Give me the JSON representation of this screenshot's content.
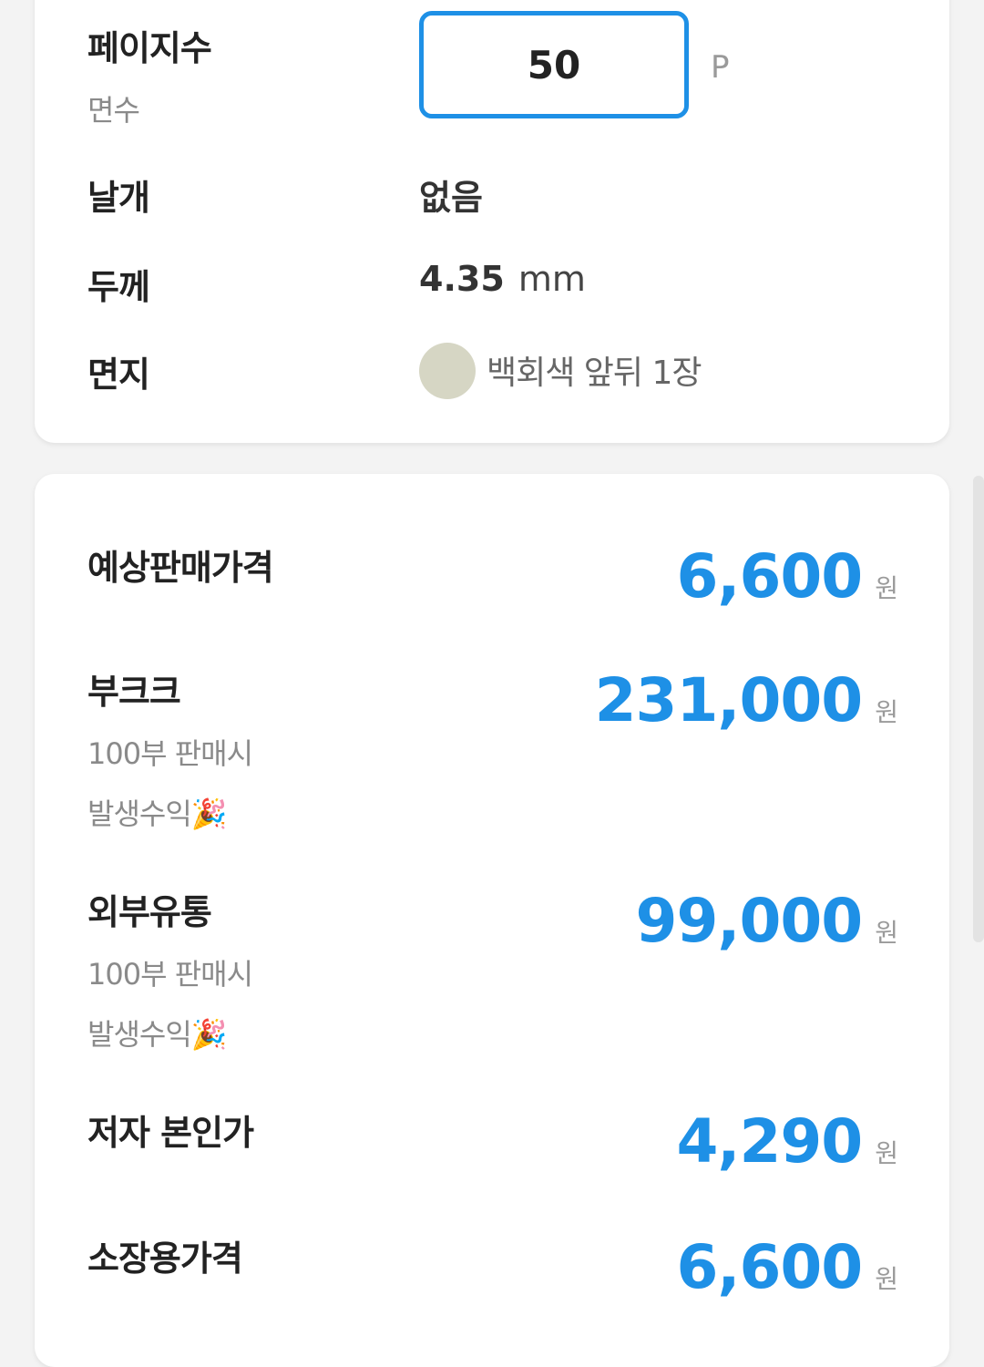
{
  "specs": {
    "pages": {
      "label": "페이지수",
      "sublabel": "면수",
      "value": "50",
      "unit": "P"
    },
    "wings": {
      "label": "날개",
      "value": "없음"
    },
    "thickness": {
      "label": "두께",
      "value": "4.35",
      "unit": "mm"
    },
    "endpaper": {
      "label": "면지",
      "swatch_color": "#d6d6c4",
      "value": "백회색 앞뒤 1장"
    }
  },
  "prices": {
    "expected": {
      "label": "예상판매가격",
      "value": "6,600",
      "unit": "원"
    },
    "bookk": {
      "label": "부크크",
      "sub1": "100부 판매시",
      "sub2": "발생수익🎉",
      "value": "231,000",
      "unit": "원"
    },
    "external": {
      "label": "외부유통",
      "sub1": "100부 판매시",
      "sub2": "발생수익🎉",
      "value": "99,000",
      "unit": "원"
    },
    "author": {
      "label": "저자 본인가",
      "value": "4,290",
      "unit": "원"
    },
    "collector": {
      "label": "소장용가격",
      "value": "6,600",
      "unit": "원"
    }
  },
  "theme": {
    "accent": "#1e90e6"
  }
}
